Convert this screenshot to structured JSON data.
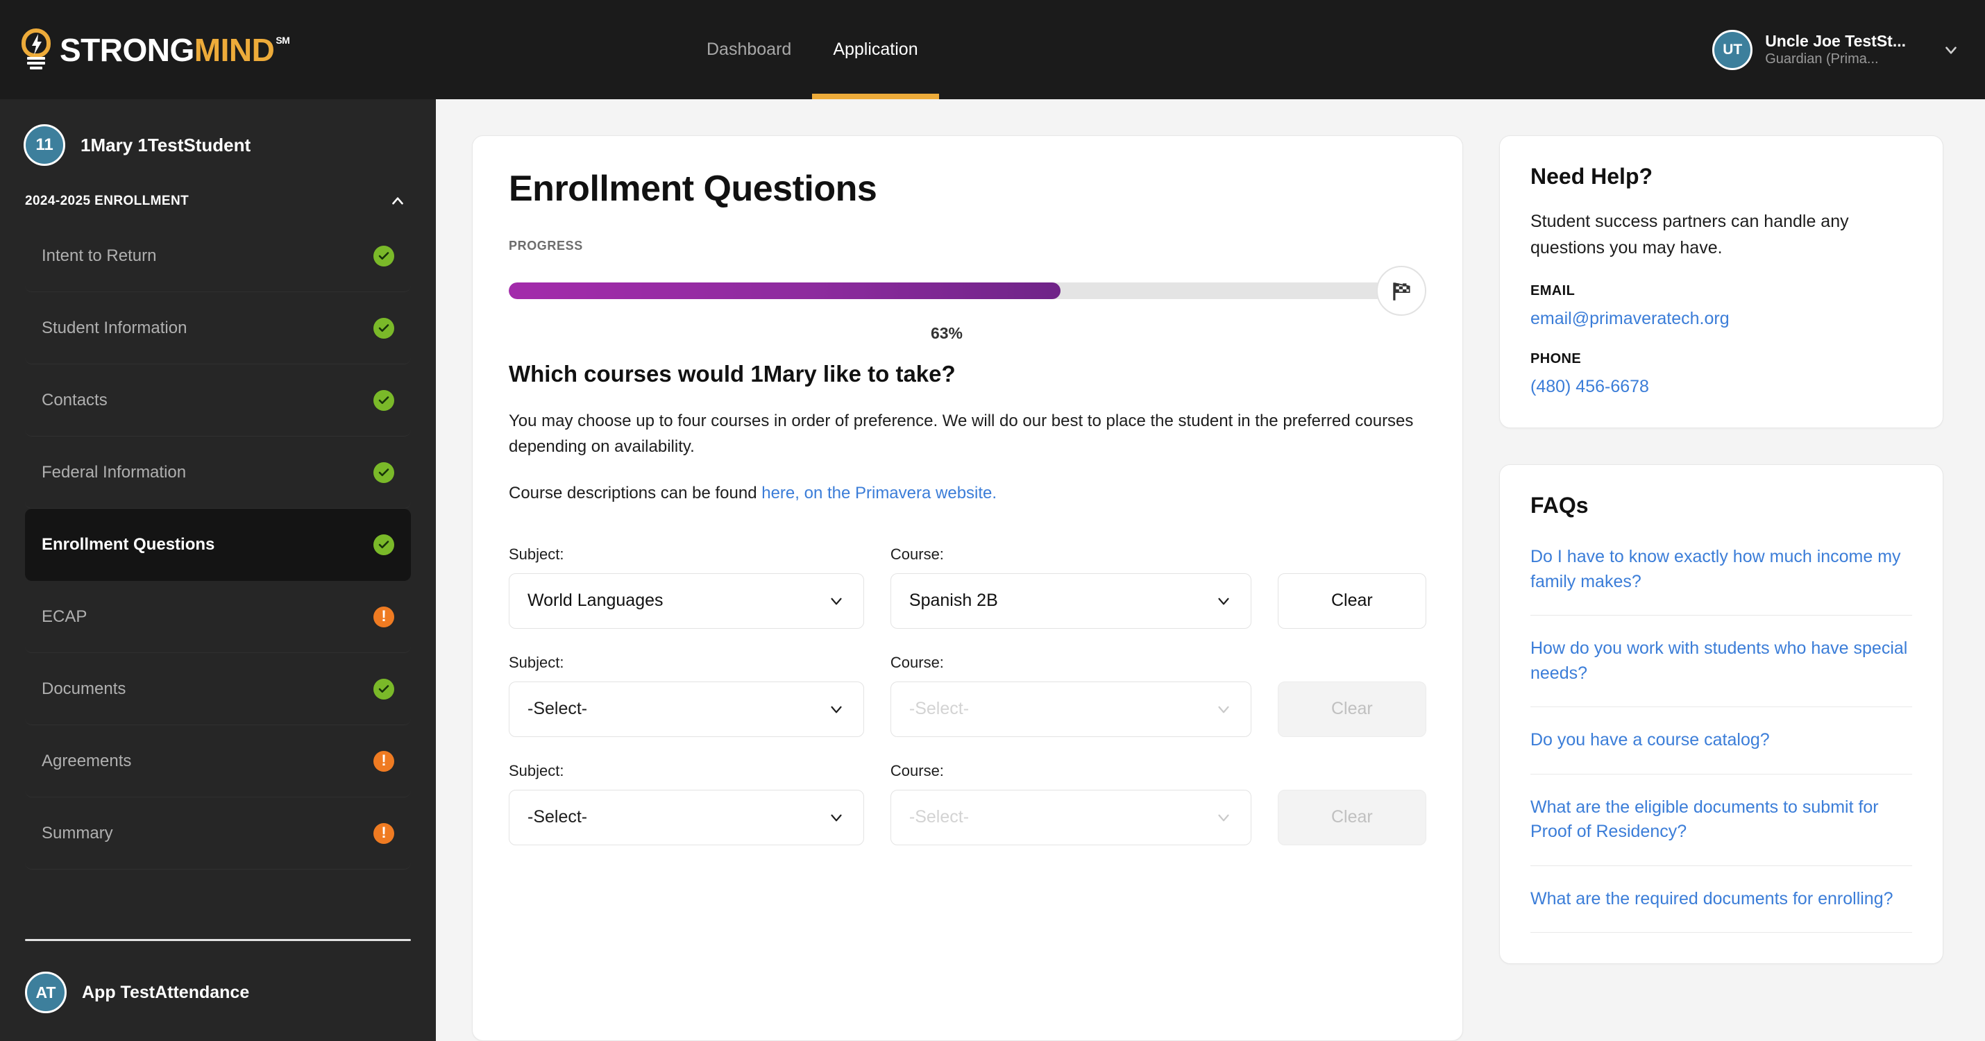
{
  "brand": {
    "name_part1": "STRONG",
    "name_part2": "MIND",
    "trademark": "SM",
    "icon": "lightbulb-icon",
    "color_primary": "#edab3a",
    "color_text": "#ffffff"
  },
  "topnav": {
    "items": [
      {
        "label": "Dashboard",
        "active": false
      },
      {
        "label": "Application",
        "active": true
      }
    ],
    "active_underline_color": "#edab3a"
  },
  "user": {
    "initials": "UT",
    "name": "Uncle Joe TestSt...",
    "role": "Guardian (Prima...",
    "avatar_color": "#3d7f9c",
    "chevron": "chevron-down-icon"
  },
  "sidebar": {
    "student": {
      "initials": "11",
      "name": "1Mary 1TestStudent",
      "avatar_color": "#3d7f9c"
    },
    "section": {
      "label": "2024-2025 ENROLLMENT",
      "collapse_icon": "chevron-up-icon"
    },
    "items": [
      {
        "label": "Intent to Return",
        "status": "complete",
        "active": false
      },
      {
        "label": "Student Information",
        "status": "complete",
        "active": false
      },
      {
        "label": "Contacts",
        "status": "complete",
        "active": false
      },
      {
        "label": "Federal Information",
        "status": "complete",
        "active": false
      },
      {
        "label": "Enrollment Questions",
        "status": "complete",
        "active": true
      },
      {
        "label": "ECAP",
        "status": "incomplete",
        "active": false
      },
      {
        "label": "Documents",
        "status": "complete",
        "active": false
      },
      {
        "label": "Agreements",
        "status": "incomplete",
        "active": false
      },
      {
        "label": "Summary",
        "status": "incomplete",
        "active": false
      }
    ],
    "status_colors": {
      "complete": "#7ab929",
      "incomplete": "#ef7b22"
    },
    "footer_user": {
      "initials": "AT",
      "name": "App TestAttendance",
      "avatar_color": "#3d7f9c"
    }
  },
  "main": {
    "title": "Enrollment Questions",
    "progress": {
      "label": "PROGRESS",
      "percent_text": "63%",
      "percent_value": 63,
      "fill_color": "#8d2b9e",
      "track_color": "#e4e4e4",
      "end_icon": "checkered-flag-icon"
    },
    "question": "Which courses would 1Mary like to take?",
    "description": "You may choose up to four courses in order of preference. We will do our best to place the student in the preferred courses depending on availability.",
    "link_prefix": "Course descriptions can be found ",
    "link_text": "here, on the Primavera website.",
    "labels": {
      "subject": "Subject:",
      "course": "Course:"
    },
    "clear_label": "Clear",
    "select_placeholder": "-Select-",
    "dropdown_icon": "chevron-down-icon",
    "rows": [
      {
        "subject": "World Languages",
        "course": "Spanish 2B",
        "subject_empty": false,
        "course_disabled": false,
        "clear_disabled": false
      },
      {
        "subject": "-Select-",
        "course": "-Select-",
        "subject_empty": true,
        "course_disabled": true,
        "clear_disabled": true
      },
      {
        "subject": "-Select-",
        "course": "-Select-",
        "subject_empty": true,
        "course_disabled": true,
        "clear_disabled": true
      }
    ]
  },
  "rail": {
    "help": {
      "title": "Need Help?",
      "body": "Student success partners can handle any questions you may have.",
      "email_label": "EMAIL",
      "email_value": "email@primaveratech.org",
      "phone_label": "PHONE",
      "phone_value": "(480) 456-6678",
      "link_color": "#3b7dd8"
    },
    "faqs": {
      "title": "FAQs",
      "items": [
        "Do I have to know exactly how much income my family makes?",
        "How do you work with students who have special needs?",
        "Do you have a course catalog?",
        "What are the eligible documents to submit for Proof of Residency?",
        "What are the required documents for enrolling?"
      ]
    }
  }
}
